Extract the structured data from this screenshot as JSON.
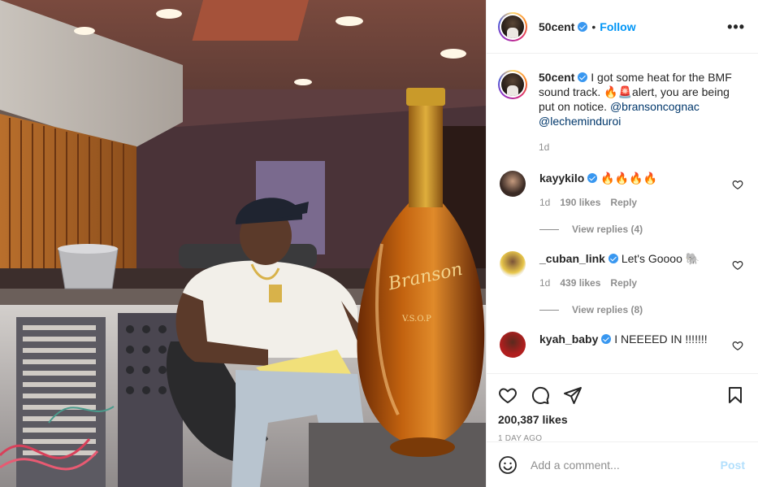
{
  "post": {
    "username": "50cent",
    "follow_label": "Follow",
    "separator": "•",
    "more_label": "•••"
  },
  "caption": {
    "username": "50cent",
    "text_1": "I got some heat for the BMF sound track. ",
    "emoji": "🔥🚨",
    "text_2": "alert, you are being put on notice. ",
    "mention_1": "@bransoncognac",
    "mention_2": "@lecheminduroi",
    "age": "1d"
  },
  "comments": [
    {
      "username": "kayykilo",
      "text": "🔥🔥🔥🔥",
      "age": "1d",
      "likes": "190 likes",
      "reply_label": "Reply",
      "view_replies": "View replies (4)",
      "avatar_color": "#3a2a24"
    },
    {
      "username": "_cuban_link",
      "text": "Let's Goooo 🐘",
      "age": "1d",
      "likes": "439 likes",
      "reply_label": "Reply",
      "view_replies": "View replies (8)",
      "avatar_color": "#e8c64a"
    },
    {
      "username": "kyah_baby",
      "text": "I NEEEED IN !!!!!!!",
      "avatar_color": "#b01e1e"
    }
  ],
  "stats": {
    "likes": "200,387 likes",
    "date": "1 DAY AGO"
  },
  "composer": {
    "placeholder": "Add a comment...",
    "post_label": "Post"
  },
  "icons": {
    "like": "heart-icon",
    "comment": "comment-icon",
    "share": "paper-plane-icon",
    "save": "bookmark-icon",
    "emoji": "smiley-icon",
    "options": "more-options-icon",
    "verified": "verified-badge-icon"
  },
  "colors": {
    "link_blue": "#0095f6",
    "verified_blue": "#3897f0",
    "muted_gray": "#8e8e8e",
    "post_disabled": "#b2dffc"
  },
  "photo": {
    "bottle_text_1": "Branson",
    "bottle_text_2": "V.S.O.P"
  }
}
